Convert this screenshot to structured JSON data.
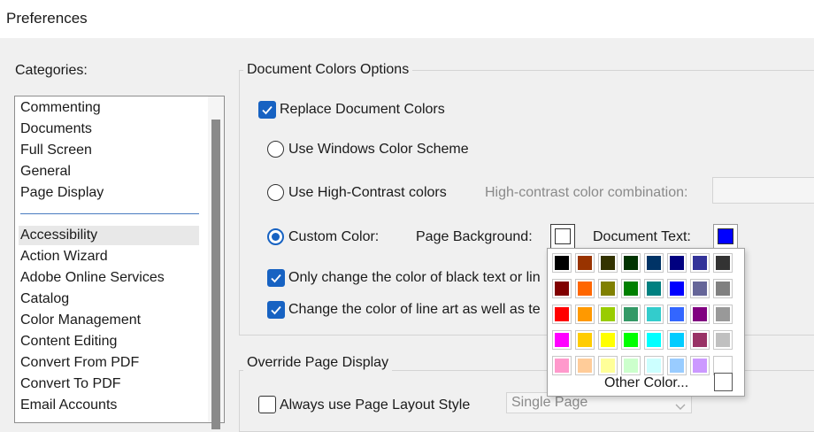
{
  "window": {
    "title": "Preferences"
  },
  "categories": {
    "label": "Categories:",
    "group1": [
      "Commenting",
      "Documents",
      "Full Screen",
      "General",
      "Page Display"
    ],
    "group2": [
      "Accessibility",
      "Action Wizard",
      "Adobe Online Services",
      "Catalog",
      "Color Management",
      "Content Editing",
      "Convert From PDF",
      "Convert To PDF",
      "Email Accounts"
    ],
    "selected": "Accessibility"
  },
  "document_colors": {
    "title": "Document Colors Options",
    "replace_label": "Replace Document Colors",
    "replace_checked": true,
    "windows_scheme_label": "Use Windows Color Scheme",
    "high_contrast_label": "Use High-Contrast colors",
    "high_contrast_combo_label": "High-contrast color combination:",
    "custom_label": "Custom Color:",
    "selected_option": "custom",
    "page_background_label": "Page Background:",
    "page_background_color": "#ffffff",
    "document_text_label": "Document Text:",
    "document_text_color": "#0000ff",
    "only_black_label": "Only change the color of black text or lin",
    "only_black_checked": true,
    "line_art_label": "Change the color of line art as well as te",
    "line_art_checked": true
  },
  "override": {
    "title": "Override Page Display",
    "always_layout_label": "Always use Page Layout Style",
    "always_layout_checked": false,
    "layout_value": "Single Page"
  },
  "palette": {
    "rows": [
      [
        "#000000",
        "#993300",
        "#333300",
        "#003300",
        "#003366",
        "#000080",
        "#333399",
        "#333333"
      ],
      [
        "#800000",
        "#ff6600",
        "#808000",
        "#008000",
        "#008080",
        "#0000ff",
        "#666699",
        "#808080"
      ],
      [
        "#ff0000",
        "#ff9900",
        "#99cc00",
        "#339966",
        "#33cccc",
        "#3366ff",
        "#800080",
        "#999999"
      ],
      [
        "#ff00ff",
        "#ffcc00",
        "#ffff00",
        "#00ff00",
        "#00ffff",
        "#00ccff",
        "#993366",
        "#c0c0c0"
      ],
      [
        "#ff99cc",
        "#ffcc99",
        "#ffff99",
        "#ccffcc",
        "#ccffff",
        "#99ccff",
        "#cc99ff",
        "#ffffff"
      ]
    ],
    "other_color_label": "Other Color..."
  }
}
